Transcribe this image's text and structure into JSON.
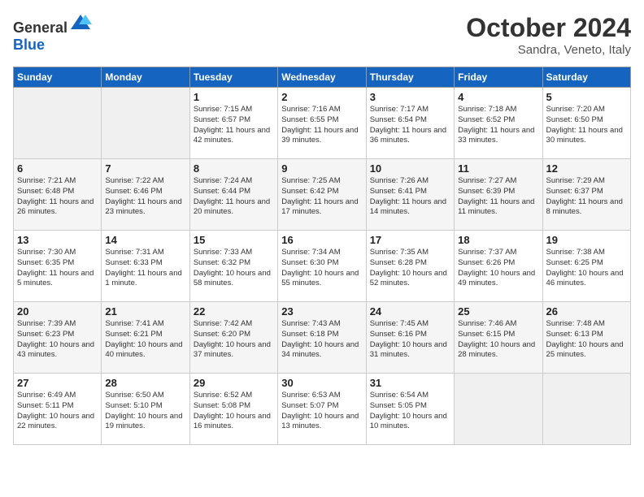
{
  "header": {
    "logo": {
      "general": "General",
      "blue": "Blue"
    },
    "title": "October 2024",
    "subtitle": "Sandra, Veneto, Italy"
  },
  "columns": [
    "Sunday",
    "Monday",
    "Tuesday",
    "Wednesday",
    "Thursday",
    "Friday",
    "Saturday"
  ],
  "weeks": [
    [
      {
        "day": "",
        "info": ""
      },
      {
        "day": "",
        "info": ""
      },
      {
        "day": "1",
        "info": "Sunrise: 7:15 AM\nSunset: 6:57 PM\nDaylight: 11 hours and 42 minutes."
      },
      {
        "day": "2",
        "info": "Sunrise: 7:16 AM\nSunset: 6:55 PM\nDaylight: 11 hours and 39 minutes."
      },
      {
        "day": "3",
        "info": "Sunrise: 7:17 AM\nSunset: 6:54 PM\nDaylight: 11 hours and 36 minutes."
      },
      {
        "day": "4",
        "info": "Sunrise: 7:18 AM\nSunset: 6:52 PM\nDaylight: 11 hours and 33 minutes."
      },
      {
        "day": "5",
        "info": "Sunrise: 7:20 AM\nSunset: 6:50 PM\nDaylight: 11 hours and 30 minutes."
      }
    ],
    [
      {
        "day": "6",
        "info": "Sunrise: 7:21 AM\nSunset: 6:48 PM\nDaylight: 11 hours and 26 minutes."
      },
      {
        "day": "7",
        "info": "Sunrise: 7:22 AM\nSunset: 6:46 PM\nDaylight: 11 hours and 23 minutes."
      },
      {
        "day": "8",
        "info": "Sunrise: 7:24 AM\nSunset: 6:44 PM\nDaylight: 11 hours and 20 minutes."
      },
      {
        "day": "9",
        "info": "Sunrise: 7:25 AM\nSunset: 6:42 PM\nDaylight: 11 hours and 17 minutes."
      },
      {
        "day": "10",
        "info": "Sunrise: 7:26 AM\nSunset: 6:41 PM\nDaylight: 11 hours and 14 minutes."
      },
      {
        "day": "11",
        "info": "Sunrise: 7:27 AM\nSunset: 6:39 PM\nDaylight: 11 hours and 11 minutes."
      },
      {
        "day": "12",
        "info": "Sunrise: 7:29 AM\nSunset: 6:37 PM\nDaylight: 11 hours and 8 minutes."
      }
    ],
    [
      {
        "day": "13",
        "info": "Sunrise: 7:30 AM\nSunset: 6:35 PM\nDaylight: 11 hours and 5 minutes."
      },
      {
        "day": "14",
        "info": "Sunrise: 7:31 AM\nSunset: 6:33 PM\nDaylight: 11 hours and 1 minute."
      },
      {
        "day": "15",
        "info": "Sunrise: 7:33 AM\nSunset: 6:32 PM\nDaylight: 10 hours and 58 minutes."
      },
      {
        "day": "16",
        "info": "Sunrise: 7:34 AM\nSunset: 6:30 PM\nDaylight: 10 hours and 55 minutes."
      },
      {
        "day": "17",
        "info": "Sunrise: 7:35 AM\nSunset: 6:28 PM\nDaylight: 10 hours and 52 minutes."
      },
      {
        "day": "18",
        "info": "Sunrise: 7:37 AM\nSunset: 6:26 PM\nDaylight: 10 hours and 49 minutes."
      },
      {
        "day": "19",
        "info": "Sunrise: 7:38 AM\nSunset: 6:25 PM\nDaylight: 10 hours and 46 minutes."
      }
    ],
    [
      {
        "day": "20",
        "info": "Sunrise: 7:39 AM\nSunset: 6:23 PM\nDaylight: 10 hours and 43 minutes."
      },
      {
        "day": "21",
        "info": "Sunrise: 7:41 AM\nSunset: 6:21 PM\nDaylight: 10 hours and 40 minutes."
      },
      {
        "day": "22",
        "info": "Sunrise: 7:42 AM\nSunset: 6:20 PM\nDaylight: 10 hours and 37 minutes."
      },
      {
        "day": "23",
        "info": "Sunrise: 7:43 AM\nSunset: 6:18 PM\nDaylight: 10 hours and 34 minutes."
      },
      {
        "day": "24",
        "info": "Sunrise: 7:45 AM\nSunset: 6:16 PM\nDaylight: 10 hours and 31 minutes."
      },
      {
        "day": "25",
        "info": "Sunrise: 7:46 AM\nSunset: 6:15 PM\nDaylight: 10 hours and 28 minutes."
      },
      {
        "day": "26",
        "info": "Sunrise: 7:48 AM\nSunset: 6:13 PM\nDaylight: 10 hours and 25 minutes."
      }
    ],
    [
      {
        "day": "27",
        "info": "Sunrise: 6:49 AM\nSunset: 5:11 PM\nDaylight: 10 hours and 22 minutes."
      },
      {
        "day": "28",
        "info": "Sunrise: 6:50 AM\nSunset: 5:10 PM\nDaylight: 10 hours and 19 minutes."
      },
      {
        "day": "29",
        "info": "Sunrise: 6:52 AM\nSunset: 5:08 PM\nDaylight: 10 hours and 16 minutes."
      },
      {
        "day": "30",
        "info": "Sunrise: 6:53 AM\nSunset: 5:07 PM\nDaylight: 10 hours and 13 minutes."
      },
      {
        "day": "31",
        "info": "Sunrise: 6:54 AM\nSunset: 5:05 PM\nDaylight: 10 hours and 10 minutes."
      },
      {
        "day": "",
        "info": ""
      },
      {
        "day": "",
        "info": ""
      }
    ]
  ]
}
